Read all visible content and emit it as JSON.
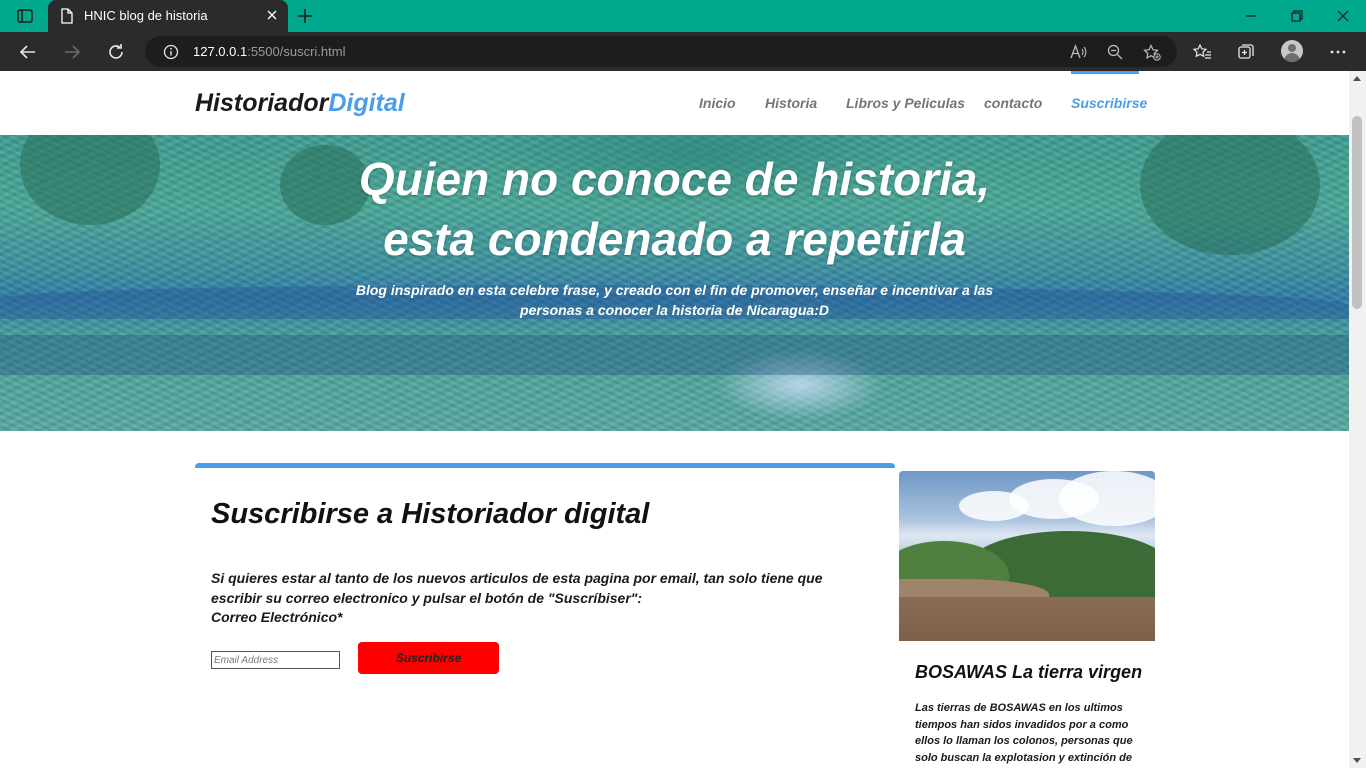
{
  "browser": {
    "tab_title": "HNIC blog de historia",
    "url_host": "127.0.0.1",
    "url_rest": ":5500/suscri.html"
  },
  "site": {
    "brand_main": "Historiador",
    "brand_accent": "Digital",
    "nav": {
      "inicio": "Inicio",
      "historia": "Historia",
      "libros": "Libros y Peliculas",
      "contacto": "contacto",
      "suscribirse": "Suscribirse"
    },
    "active_nav": "Suscribirse",
    "accent_color": "#4a9de8"
  },
  "hero": {
    "title_line1": "Quien no conoce de historia,",
    "title_line2": "esta condenado a repetirla",
    "subtitle": "Blog inspirado en esta celebre frase, y creado con el fin de promover, enseñar e incentivar a las personas a conocer la historia de Nicaragua:D"
  },
  "subscribe": {
    "title": "Suscribirse a Historiador digital",
    "text_line1": "Si quieres estar al tanto de los nuevos articulos de esta pagina por email, tan solo tiene que escribir su correo electronico y pulsar el botón de \"Suscríbiser\":",
    "text_line2": "Correo Electrónico*",
    "email_placeholder": "Email Address",
    "button_label": "Suscribirse",
    "button_color": "#ff0000"
  },
  "sidebar_post": {
    "title": "BOSAWAS La tierra virgen",
    "excerpt": "Las tierras de BOSAWAS en los ultimos tiempos han sidos invadidos por a como ellos lo llaman los colonos, personas que solo buscan la explotasion y extinción de"
  }
}
